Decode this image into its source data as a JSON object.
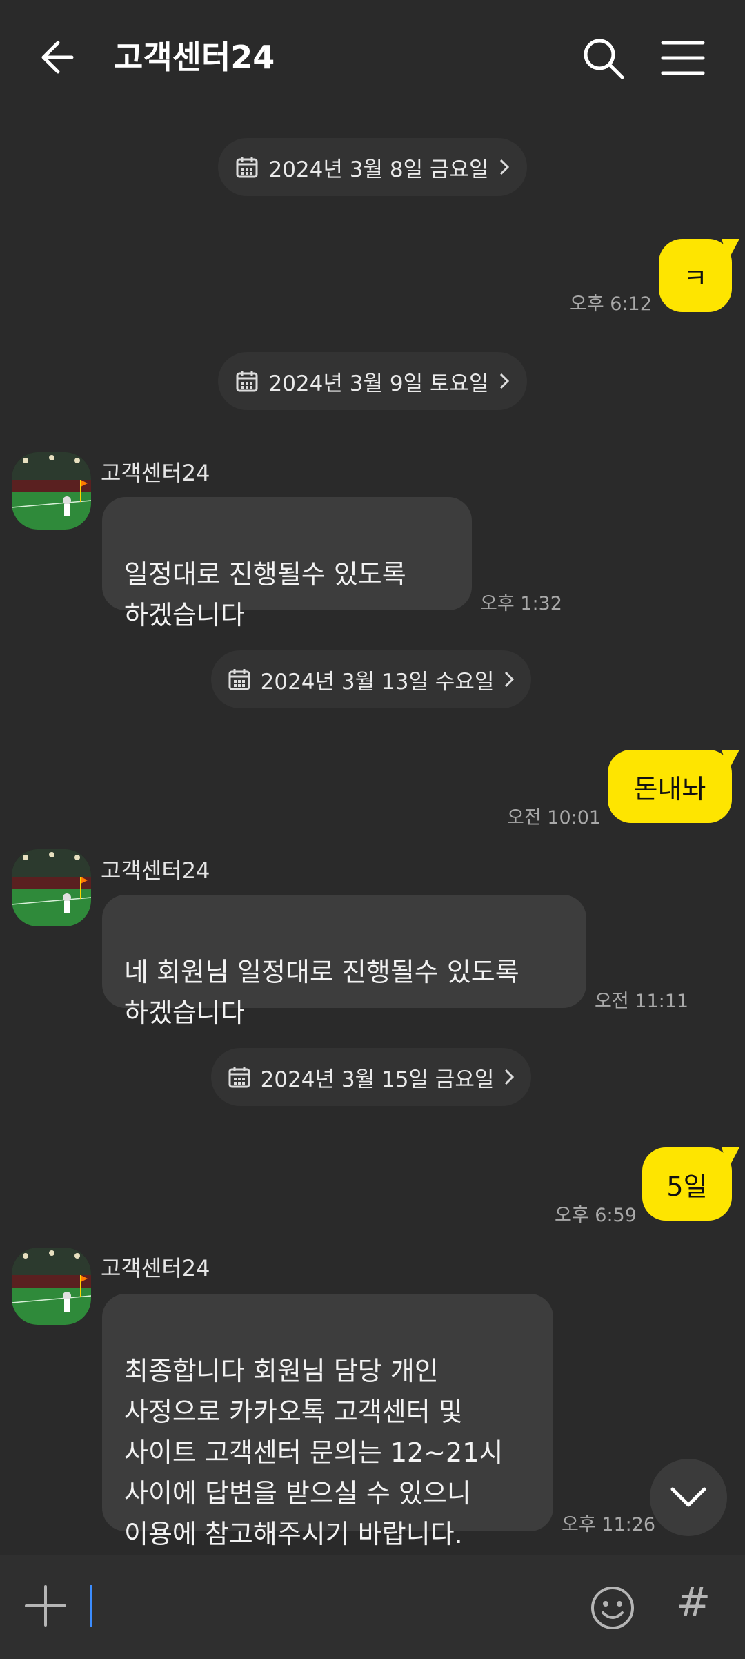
{
  "header": {
    "title": "고객센터24",
    "back_icon": "arrow-left-icon",
    "search_icon": "search-icon",
    "menu_icon": "hamburger-menu-icon"
  },
  "dates": [
    "2024년 3월 8일 금요일",
    "2024년 3월 9일 토요일",
    "2024년 3월 13일 수요일",
    "2024년 3월 15일 금요일"
  ],
  "messages": [
    {
      "side": "me",
      "text": "ㅋ",
      "time": "오후 6:12"
    },
    {
      "side": "them",
      "sender": "고객센터24",
      "text": " 일정대로 진행될수 있도록\n하겠습니다",
      "time": "오후 1:32"
    },
    {
      "side": "me",
      "text": "돈내놔",
      "time": "오전 10:01"
    },
    {
      "side": "them",
      "sender": "고객센터24",
      "text": "네 회원님 일정대로 진행될수 있도록\n하겠습니다",
      "time": "오전 11:11"
    },
    {
      "side": "me",
      "text": "5일",
      "time": "오후 6:59"
    },
    {
      "side": "them",
      "sender": "고객센터24",
      "text": "최종합니다 회원님 담당 개인\n사정으로 카카오톡 고객센터 및\n사이트 고객센터 문의는 12~21시\n사이에 답변을 받으실 수 있으니\n이용에 참고해주시기 바랍니다.",
      "time": "오후 11:26"
    }
  ],
  "input": {
    "plus_icon": "plus-icon",
    "emoji_icon": "emoji-icon",
    "hash_label": "#"
  },
  "colors": {
    "background": "#2a2a2a",
    "my_bubble": "#fee500",
    "their_bubble": "#3d3d3d",
    "date_pill": "#333333",
    "cursor": "#3c8dff"
  }
}
